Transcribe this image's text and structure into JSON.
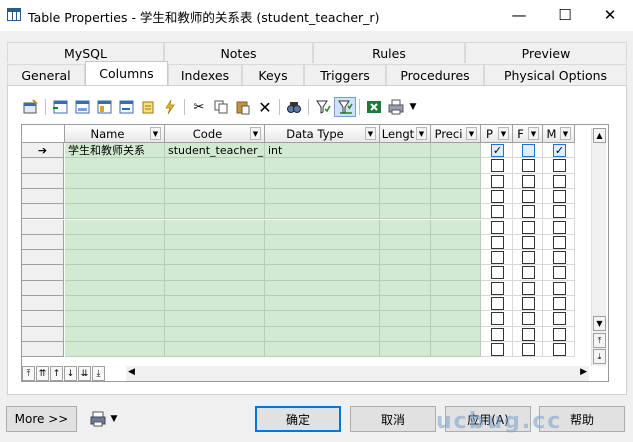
{
  "window": {
    "title": "Table Properties - 学生和教师的关系表 (student_teacher_r)",
    "minimize_glyph": "—",
    "maximize_glyph": "☐",
    "close_glyph": "✕"
  },
  "tabs_back": [
    "MySQL",
    "Notes",
    "Rules",
    "Preview"
  ],
  "tabs_front": [
    "General",
    "Columns",
    "Indexes",
    "Keys",
    "Triggers",
    "Procedures",
    "Physical Options"
  ],
  "active_tab": "Columns",
  "toolbar_icons": [
    "properties-icon",
    "insert-row-icon",
    "add-row-icon",
    "add-columns-icon",
    "reuse-columns-icon",
    "new-domain-icon",
    "delete-icon",
    "cut-icon",
    "copy-icon",
    "paste-icon",
    "delete-x-icon",
    "find-icon",
    "filter-icon",
    "customize-columns-icon",
    "excel-icon",
    "print-icon"
  ],
  "grid": {
    "headers": [
      "Name",
      "Code",
      "Data Type",
      "Lengt",
      "Preci",
      "P",
      "F",
      "M"
    ],
    "rows": [
      {
        "marker": "➔",
        "name": "学生和教师关系",
        "code": "student_teacher_r",
        "data_type": "int",
        "length": "",
        "precision": "",
        "p": true,
        "f": false,
        "m": true
      }
    ],
    "empty_rows": 13
  },
  "nav_buttons": [
    "⤒",
    "⇈",
    "↑",
    "↓",
    "⇊",
    "⤓"
  ],
  "bottom": {
    "more_label": "More >>",
    "ok_label": "确定",
    "cancel_label": "取消",
    "apply_label": "应用(A)",
    "help_label": "帮助"
  },
  "watermark": "ucbug.cc"
}
